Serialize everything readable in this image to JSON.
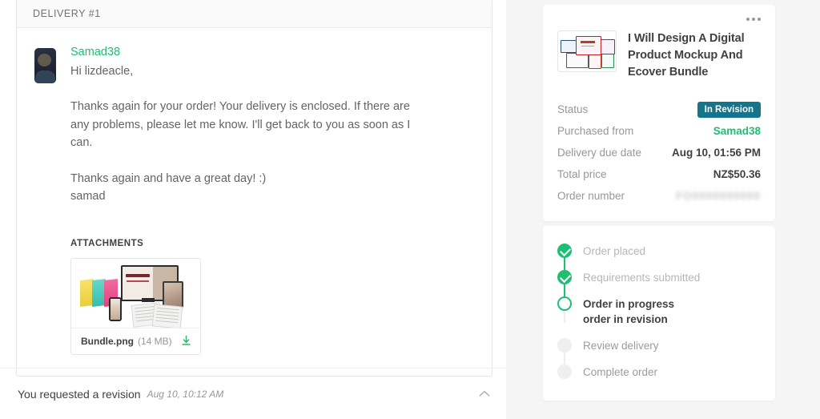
{
  "delivery": {
    "header_title": "DELIVERY #1",
    "sender": "Samad38",
    "greeting": "Hi lizdeacle,",
    "body_paragraph": "Thanks again for your order! Your delivery is enclosed. If there are any problems, please let me know. I'll get back to you as soon as I can.",
    "closing": "Thanks again and have a great day! :)",
    "signature": "samad",
    "attachments_label": "ATTACHMENTS",
    "attachment": {
      "filename": "Bundle.png",
      "filesize": "(14 MB)",
      "download_icon": "download-icon",
      "thumbnail_alt": "product-bundle-mockup"
    }
  },
  "revision_notice": {
    "title": "You requested a revision",
    "timestamp": "Aug 10, 10:12 AM",
    "collapse_icon": "chevron-up-icon"
  },
  "order_panel": {
    "menu_icon": "kebab-menu-icon",
    "gig_title": "I Will Design A Digital Product Mockup And Ecover Bundle",
    "gig_thumbnail_alt": "gig-preview-thumbnail",
    "details": [
      {
        "label": "Status",
        "value": "In Revision",
        "type": "badge"
      },
      {
        "label": "Purchased from",
        "value": "Samad38",
        "type": "link"
      },
      {
        "label": "Delivery due date",
        "value": "Aug 10, 01:56 PM",
        "type": "text"
      },
      {
        "label": "Total price",
        "value": "NZ$50.36",
        "type": "text"
      },
      {
        "label": "Order number",
        "value": "FO0000000000",
        "type": "blurred"
      }
    ]
  },
  "timeline": {
    "steps": [
      {
        "label": "Order placed",
        "state": "done"
      },
      {
        "label": "Requirements submitted",
        "state": "done"
      },
      {
        "label": "Order in progress",
        "sublabel": "order in revision",
        "state": "current"
      },
      {
        "label": "Review delivery",
        "state": "todo"
      },
      {
        "label": "Complete order",
        "state": "todo"
      }
    ]
  },
  "colors": {
    "brand_green": "#1dbf73",
    "badge_teal": "#15748a",
    "text_primary": "#404145",
    "text_muted": "#95979d"
  }
}
